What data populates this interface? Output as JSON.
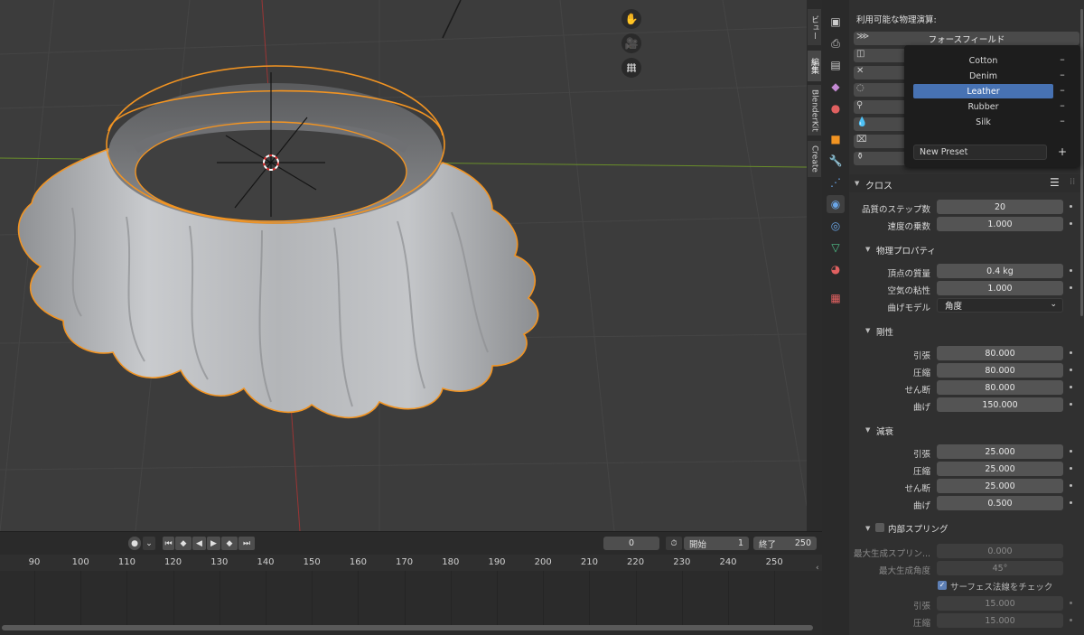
{
  "viewport": {
    "nav_icons": [
      "hand-icon",
      "camera-icon",
      "grid-icon"
    ],
    "colors": {
      "x_axis": "#9a3535",
      "y_axis": "#6a8f2a",
      "selection": "#f29422",
      "cloth": "#b9bbbe"
    }
  },
  "side_tabs": [
    {
      "label": "ビュー",
      "active": false
    },
    {
      "label": "編集",
      "active": true
    },
    {
      "label": "BlenderKit",
      "active": false
    },
    {
      "label": "Create",
      "active": false
    }
  ],
  "property_icons": [
    "render-icon",
    "output-icon",
    "view-layer-icon",
    "scene-icon",
    "world-icon",
    "object-icon",
    "modifier-icon",
    "particles-icon",
    "physics-icon",
    "constraints-icon",
    "data-icon",
    "material-icon",
    "texture-icon"
  ],
  "physics": {
    "heading": "利用可能な物理演算:",
    "force_field": "フォースフィールド",
    "icons": [
      "collision-icon",
      "close-icon",
      "cloth-icon",
      "dynamic-paint-icon",
      "fluid-icon",
      "rigid-body-icon",
      "rigid-body-constraint-icon",
      "soft-body-icon"
    ]
  },
  "preset_menu": {
    "items": [
      "Cotton",
      "Denim",
      "Leather",
      "Rubber",
      "Silk"
    ],
    "selected": "Leather",
    "new_preset": "New Preset",
    "remove": "–",
    "add": "+"
  },
  "cloth": {
    "title": "クロス",
    "quality_label": "品質のステップ数",
    "quality": "20",
    "speed_label": "速度の乗数",
    "speed": "1.000",
    "physical": {
      "title": "物理プロパティ",
      "mass_label": "頂点の質量",
      "mass": "0.4 kg",
      "air_label": "空気の粘性",
      "air": "1.000",
      "bending_model_label": "曲げモデル",
      "bending_model": "角度"
    },
    "stiffness": {
      "title": "剛性",
      "rows": [
        {
          "label": "引張",
          "value": "80.000"
        },
        {
          "label": "圧縮",
          "value": "80.000"
        },
        {
          "label": "せん断",
          "value": "80.000"
        },
        {
          "label": "曲げ",
          "value": "150.000"
        }
      ]
    },
    "damping": {
      "title": "減衰",
      "rows": [
        {
          "label": "引張",
          "value": "25.000"
        },
        {
          "label": "圧縮",
          "value": "25.000"
        },
        {
          "label": "せん断",
          "value": "25.000"
        },
        {
          "label": "曲げ",
          "value": "0.500"
        }
      ]
    },
    "internal": {
      "title": "内部スプリング",
      "max_length_label": "最大生成スプリン...",
      "max_length": "0.000",
      "max_angle_label": "最大生成角度",
      "max_angle": "45°",
      "check_normals": "サーフェス法線をチェック",
      "tension_label": "引張",
      "tension": "15.000",
      "compression_label": "圧縮",
      "compression": "15.000"
    }
  },
  "timeline": {
    "current_frame": "0",
    "start_label": "開始",
    "start": "1",
    "end_label": "終了",
    "end": "250",
    "ticks": [
      "90",
      "100",
      "110",
      "120",
      "130",
      "140",
      "150",
      "160",
      "170",
      "180",
      "190",
      "200",
      "210",
      "220",
      "230",
      "240",
      "250"
    ]
  }
}
